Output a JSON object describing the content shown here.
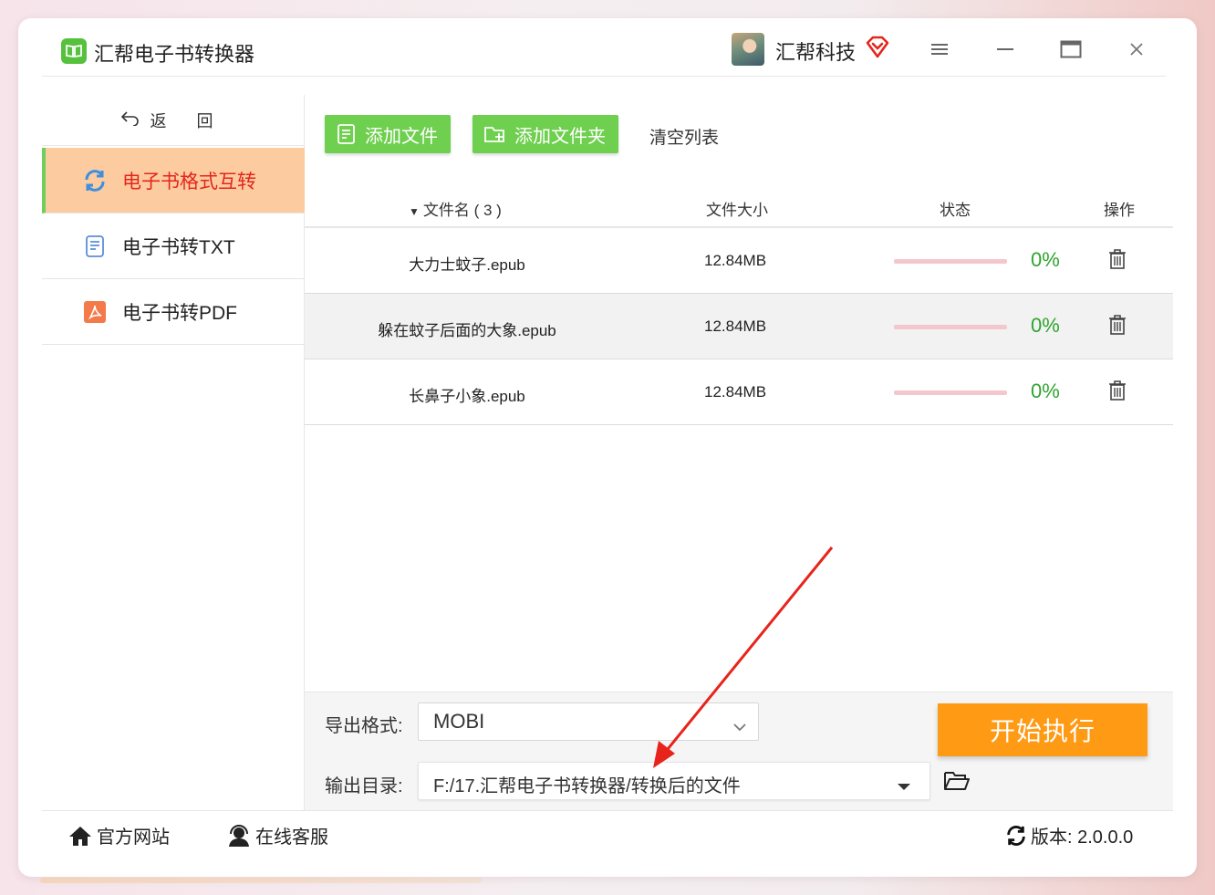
{
  "app": {
    "title": "汇帮电子书转换器",
    "user_name": "汇帮科技"
  },
  "sidebar": {
    "back_label": "返 回",
    "items": [
      {
        "label": "电子书格式互转",
        "active": true,
        "icon": "refresh-icon"
      },
      {
        "label": "电子书转TXT",
        "active": false,
        "icon": "document-icon"
      },
      {
        "label": "电子书转PDF",
        "active": false,
        "icon": "pdf-icon"
      }
    ]
  },
  "toolbar": {
    "add_file": "添加文件",
    "add_folder": "添加文件夹",
    "clear_list": "清空列表"
  },
  "table": {
    "col_name": "文件名 ( 3 )",
    "col_size": "文件大小",
    "col_status": "状态",
    "col_action": "操作",
    "rows": [
      {
        "name": "大力士蚊子.epub",
        "size": "12.84MB",
        "progress": "0%"
      },
      {
        "name": "躲在蚊子后面的大象.epub",
        "size": "12.84MB",
        "progress": "0%"
      },
      {
        "name": "长鼻子小象.epub",
        "size": "12.84MB",
        "progress": "0%"
      }
    ]
  },
  "export": {
    "format_label": "导出格式:",
    "format_value": "MOBI",
    "dir_label": "输出目录:",
    "dir_value": "F:/17.汇帮电子书转换器/转换后的文件",
    "start_label": "开始执行"
  },
  "footer": {
    "website": "官方网站",
    "service": "在线客服",
    "version": "版本:  2.0.0.0"
  },
  "colors": {
    "accent_green": "#6fcf4f",
    "active_bg": "#fdcba0",
    "active_text": "#e3261d",
    "start_orange": "#ff9a14",
    "progress_text": "#2ea42e"
  }
}
